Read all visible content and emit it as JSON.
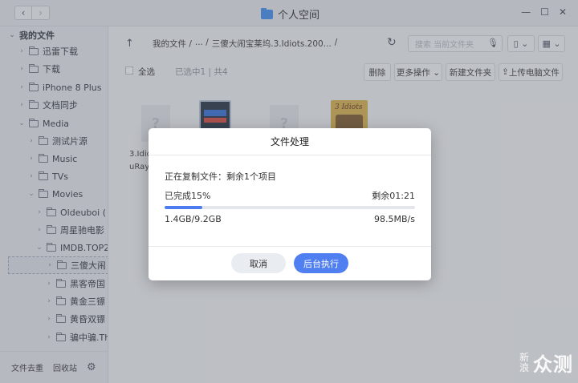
{
  "window": {
    "title": "个人空间",
    "nav_back": "‹",
    "nav_forward": "›",
    "controls": {
      "minimize": "—",
      "maximize": "☐",
      "close": "✕"
    }
  },
  "sidebar": {
    "items": [
      {
        "label": "我的文件",
        "chev": "⌄"
      },
      {
        "label": "迅雷下载",
        "chev": "›"
      },
      {
        "label": "下载",
        "chev": "›"
      },
      {
        "label": "iPhone 8 Plus",
        "chev": "›"
      },
      {
        "label": "文档同步",
        "chev": "›"
      },
      {
        "label": "Media",
        "chev": "⌄"
      },
      {
        "label": "测试片源",
        "chev": "›"
      },
      {
        "label": "Music",
        "chev": "›"
      },
      {
        "label": "TVs",
        "chev": "›"
      },
      {
        "label": "Movies",
        "chev": "⌄"
      },
      {
        "label": "Oldeuboi (",
        "chev": "›"
      },
      {
        "label": "周星驰电影",
        "chev": "›"
      },
      {
        "label": "IMDB.TOP2",
        "chev": "⌄"
      },
      {
        "label": "三傻大闹",
        "chev": "›"
      },
      {
        "label": "黑客帝国",
        "chev": "›"
      },
      {
        "label": "黄金三镖",
        "chev": "›"
      },
      {
        "label": "黄昏双镖",
        "chev": "›"
      },
      {
        "label": "骗中骗.Th",
        "chev": "›"
      }
    ],
    "bottom": {
      "trash": "文件去重",
      "recycle": "回收站"
    }
  },
  "pathbar": {
    "up": "↑",
    "crumbs": [
      "我的文件 /",
      "... /",
      "三傻大闹宝莱坞.3.Idiots.200...",
      "/"
    ],
    "refresh": "↻",
    "search_placeholder": "搜索 当前文件夹",
    "mic": "🎙"
  },
  "toolbar": {
    "select_all": "全选",
    "selection_info": "已选中1 | 共4",
    "delete": "删除",
    "more": "更多操作 ⌄",
    "new_folder": "新建文件夹",
    "upload": "上传电脑文件"
  },
  "files": [
    {
      "icon": "?",
      "label_line1": "3.Idio",
      "label_line2": "uRay."
    },
    {
      "icon": "video-thumbnail"
    },
    {
      "icon": "?"
    },
    {
      "icon": "3 Idiots poster",
      "poster_text": "3 Idiots"
    }
  ],
  "dialog": {
    "title": "文件处理",
    "status": "正在复制文件：剩余1个项目",
    "done": "已完成15%",
    "remaining": "剩余01:21",
    "progress": 0.15,
    "size": "1.4GB/9.2GB",
    "speed": "98.5MB/s",
    "cancel": "取消",
    "background": "后台执行"
  },
  "watermark": {
    "small_top": "新",
    "small_bottom": "浪",
    "big": "众测"
  },
  "colors": {
    "accent": "#4f7ff0",
    "folder": "#3d8af0"
  }
}
